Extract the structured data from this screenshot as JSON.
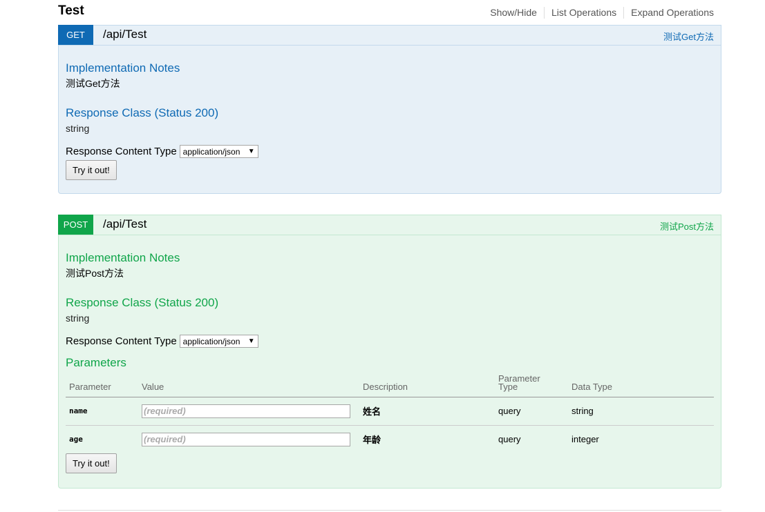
{
  "resource": {
    "title": "Test",
    "links": [
      "Show/Hide",
      "List Operations",
      "Expand Operations"
    ]
  },
  "get_op": {
    "method": "GET",
    "path": "/api/Test",
    "summary": "测试Get方法",
    "impl_notes_title": "Implementation Notes",
    "impl_notes": "测试Get方法",
    "response_class_title": "Response Class (Status 200)",
    "response_class": "string",
    "content_type_label": "Response Content Type",
    "content_type_value": "application/json",
    "try_button": "Try it out!"
  },
  "post_op": {
    "method": "POST",
    "path": "/api/Test",
    "summary": "测试Post方法",
    "impl_notes_title": "Implementation Notes",
    "impl_notes": "测试Post方法",
    "response_class_title": "Response Class (Status 200)",
    "response_class": "string",
    "content_type_label": "Response Content Type",
    "content_type_value": "application/json",
    "params_title": "Parameters",
    "params_headers": {
      "parameter": "Parameter",
      "value": "Value",
      "description": "Description",
      "param_type_line1": "Parameter",
      "param_type_line2": "Type",
      "data_type": "Data Type"
    },
    "params": [
      {
        "name": "name",
        "placeholder": "(required)",
        "description": "姓名",
        "param_type": "query",
        "data_type": "string"
      },
      {
        "name": "age",
        "placeholder": "(required)",
        "description": "年龄",
        "param_type": "query",
        "data_type": "integer"
      }
    ],
    "try_button": "Try it out!"
  },
  "colors": {
    "get_accent": "#0f6ab4",
    "get_bg": "#e7f0f7",
    "post_accent": "#10a54a",
    "post_bg": "#e7f6ec"
  }
}
